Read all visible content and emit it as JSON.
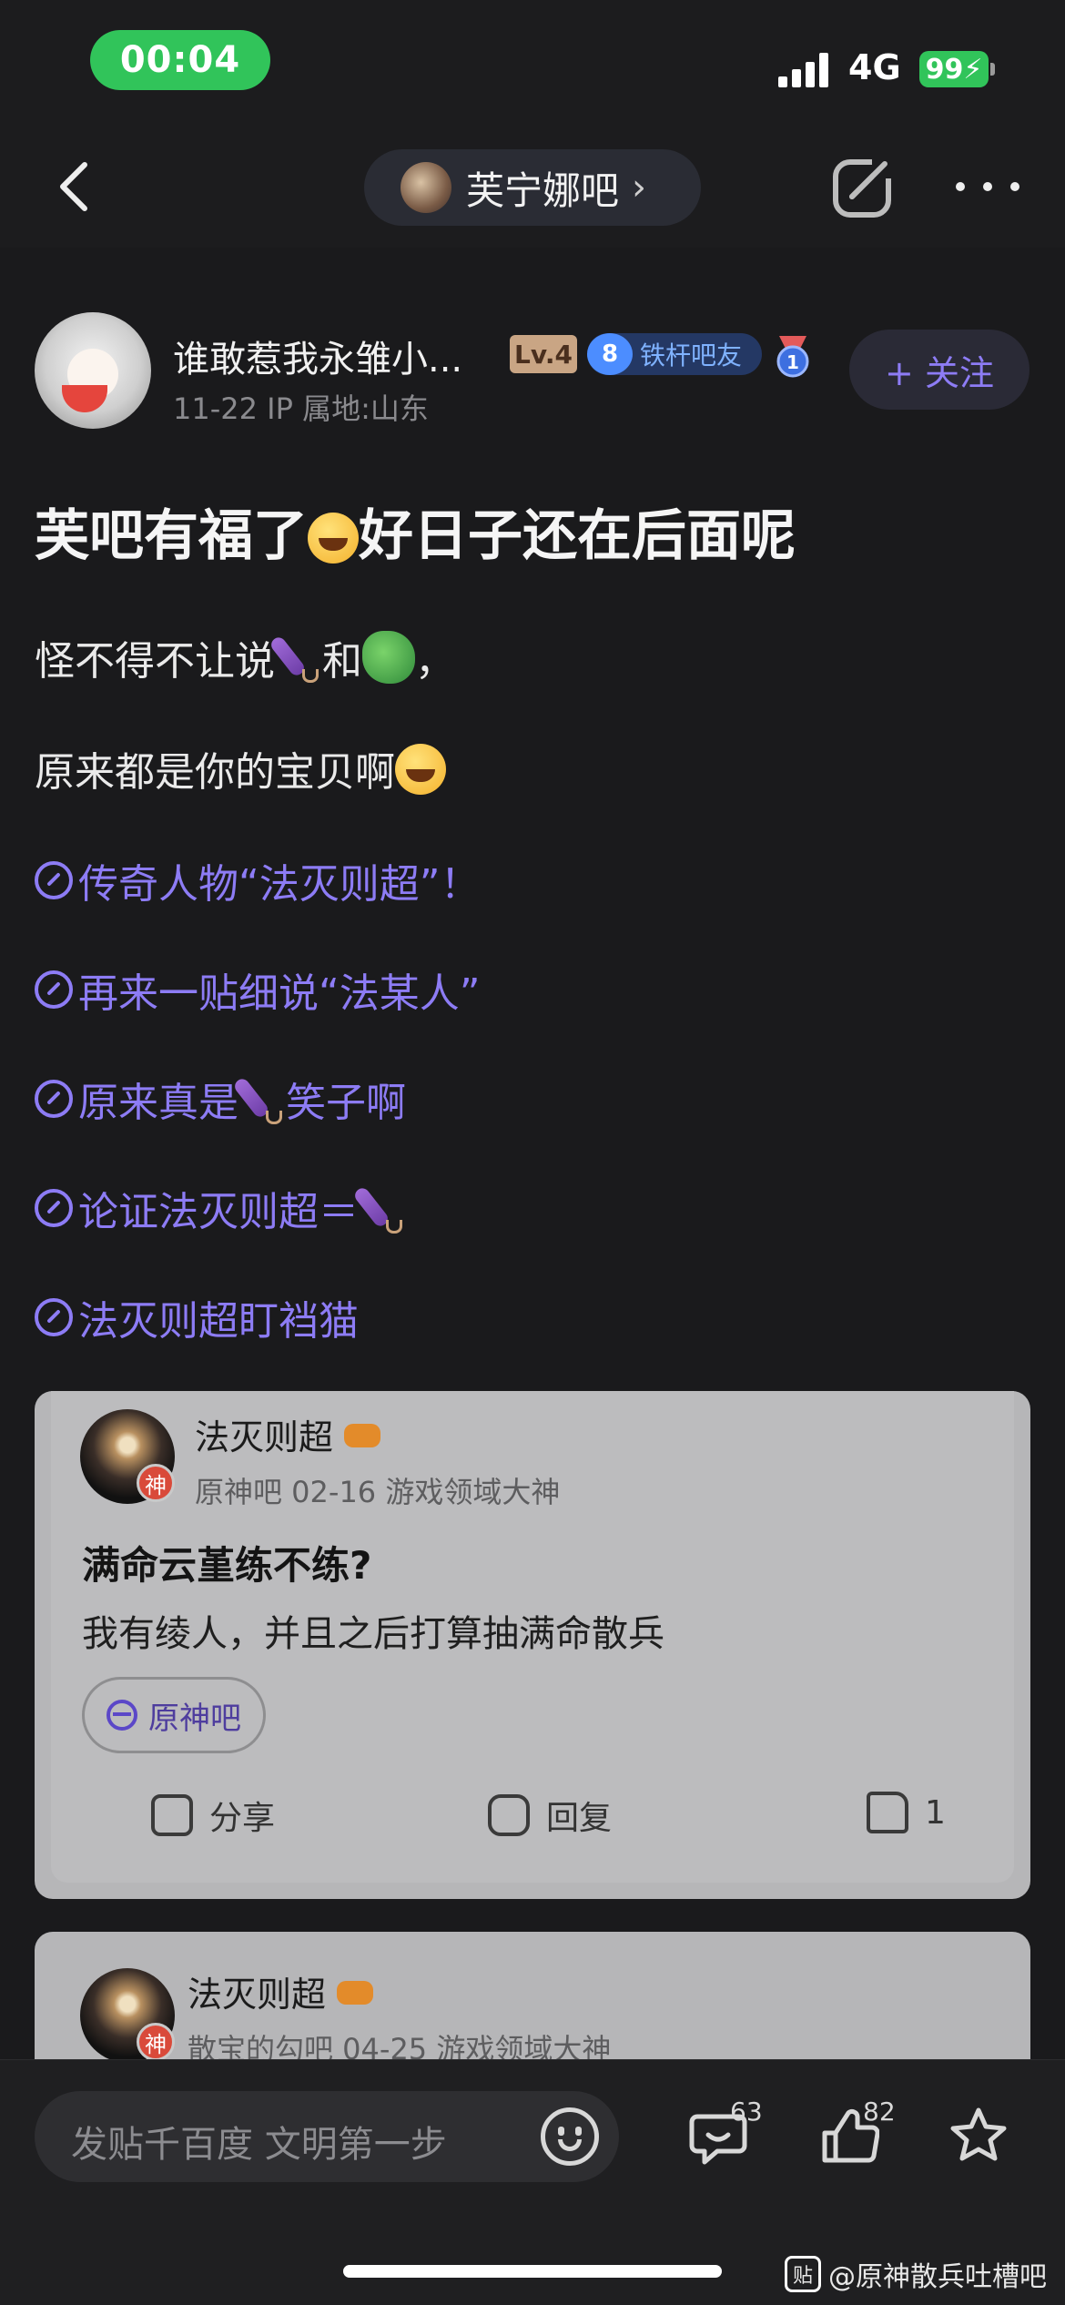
{
  "status_bar": {
    "time": "00:04",
    "network": "4G",
    "battery": "99"
  },
  "nav": {
    "forum_name": "芙宁娜吧",
    "chevron": "›"
  },
  "author": {
    "name": "谁敢惹我永雏小...",
    "level": "Lv.4",
    "rank_num": "8",
    "rank_label": "铁杆吧友",
    "medal_num": "1",
    "meta": "11-22   IP 属地:山东",
    "follow_label": "+ 关注"
  },
  "post": {
    "title_a": "芙吧有福了",
    "title_b": "好日子还在后面呢",
    "line1_a": "怪不得不让说",
    "line1_b": "和",
    "line1_c": "，",
    "line2": "原来都是你的宝贝啊",
    "links": [
      {
        "text_a": "传奇人物“法灭则超”！",
        "text_b": ""
      },
      {
        "text_a": "再来一贴细说“法某人”",
        "text_b": ""
      },
      {
        "text_a": "原来真是",
        "text_b": "笑子啊"
      },
      {
        "text_a": "论证法灭则超＝",
        "text_b": ""
      },
      {
        "text_a": "法灭则超盯裆猫",
        "text_b": ""
      }
    ]
  },
  "cards": [
    {
      "name": "法灭则超",
      "god_label": "神",
      "meta": "原神吧   02-16   游戏领域大神",
      "title": "满命云堇练不练?",
      "body": "我有绫人，并且之后打算抽满命散兵",
      "tag": "原神吧",
      "share": "分享",
      "reply": "回复",
      "likes": "1"
    },
    {
      "name": "法灭则超",
      "god_label": "神",
      "meta": "散宝的勾吧   04-25   游戏领域大神"
    }
  ],
  "bottom": {
    "compose_placeholder": "发贴千百度 文明第一步",
    "comments": "63",
    "likes": "82"
  },
  "watermark": {
    "logo": "贴",
    "text": "@原神散兵吐槽吧"
  },
  "colors": {
    "accent": "#8d7cf5",
    "status_green": "#31c45a",
    "background": "#1a1a1c"
  }
}
